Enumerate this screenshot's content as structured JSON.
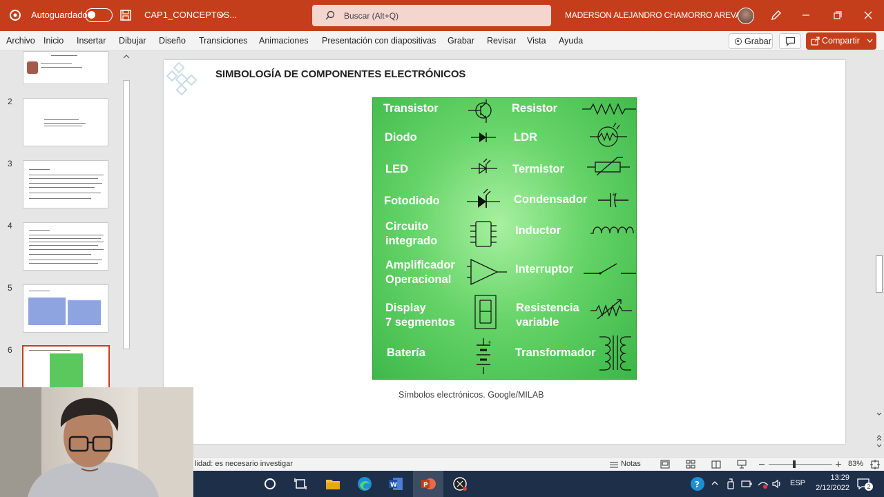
{
  "titlebar": {
    "autosave_label": "Autoguardado",
    "filename": "CAP1_CONCEPTOS...",
    "search_placeholder": "Buscar (Alt+Q)",
    "username": "MADERSON ALEJANDRO CHAMORRO AREVALO"
  },
  "ribbon": {
    "tabs": [
      "Archivo",
      "Inicio",
      "Insertar",
      "Dibujar",
      "Diseño",
      "Transiciones",
      "Animaciones",
      "Presentación con diapositivas",
      "Grabar",
      "Revisar",
      "Vista",
      "Ayuda"
    ],
    "record_label": "Grabar",
    "share_label": "Compartir"
  },
  "thumbnails": {
    "numbers": [
      "2",
      "3",
      "4",
      "5",
      "6"
    ],
    "selected": "6"
  },
  "slide": {
    "title": "SIMBOLOGÍA DE COMPONENTES ELECTRÓNICOS",
    "caption": "Símbolos electrónicos. Google/MILAB",
    "left_items": [
      "Transistor",
      "Diodo",
      "LED",
      "Fotodiodo",
      "Circuito\nintegrado",
      "Amplificador\nOperacional",
      "Display\n7 segmentos",
      "Batería"
    ],
    "right_items": [
      "Resistor",
      "LDR",
      "Termistor",
      "Condensador",
      "Inductor",
      "Interruptor",
      "Resistencia\nvariable",
      "Transformador"
    ]
  },
  "statusbar": {
    "text": "lidad: es necesario investigar",
    "notes_label": "Notas",
    "zoom": "83%"
  },
  "taskbar": {
    "language": "ESP",
    "time": "13:29",
    "date": "2/12/2022",
    "notification_count": "2"
  },
  "colors": {
    "accent": "#c43e1c",
    "panel_green": "#55c85a",
    "taskbar": "#1e2f4a"
  }
}
